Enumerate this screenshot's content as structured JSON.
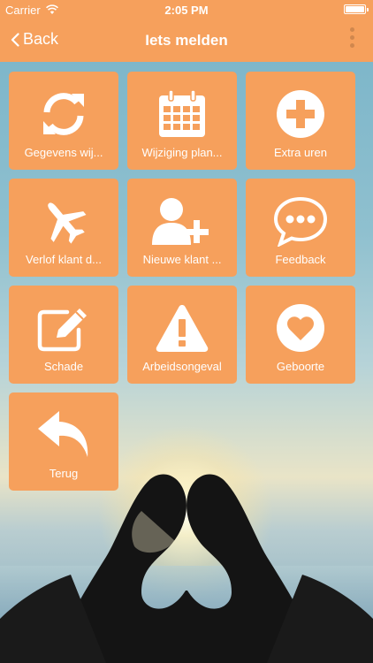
{
  "status_bar": {
    "carrier": "Carrier",
    "time": "2:05 PM"
  },
  "nav": {
    "back_label": "Back",
    "title": "Iets melden"
  },
  "colors": {
    "accent": "#f6a05c"
  },
  "tiles": [
    {
      "label": "Gegevens wij...",
      "icon": "refresh-icon"
    },
    {
      "label": "Wijziging plan...",
      "icon": "calendar-icon"
    },
    {
      "label": "Extra uren",
      "icon": "plus-circle-icon"
    },
    {
      "label": "Verlof klant d...",
      "icon": "airplane-icon"
    },
    {
      "label": "Nieuwe klant ...",
      "icon": "add-user-icon"
    },
    {
      "label": "Feedback",
      "icon": "chat-bubble-icon"
    },
    {
      "label": "Schade",
      "icon": "edit-icon"
    },
    {
      "label": "Arbeidsongeval",
      "icon": "warning-icon"
    },
    {
      "label": "Geboorte",
      "icon": "heart-circle-icon"
    },
    {
      "label": "Terug",
      "icon": "reply-arrow-icon"
    }
  ]
}
